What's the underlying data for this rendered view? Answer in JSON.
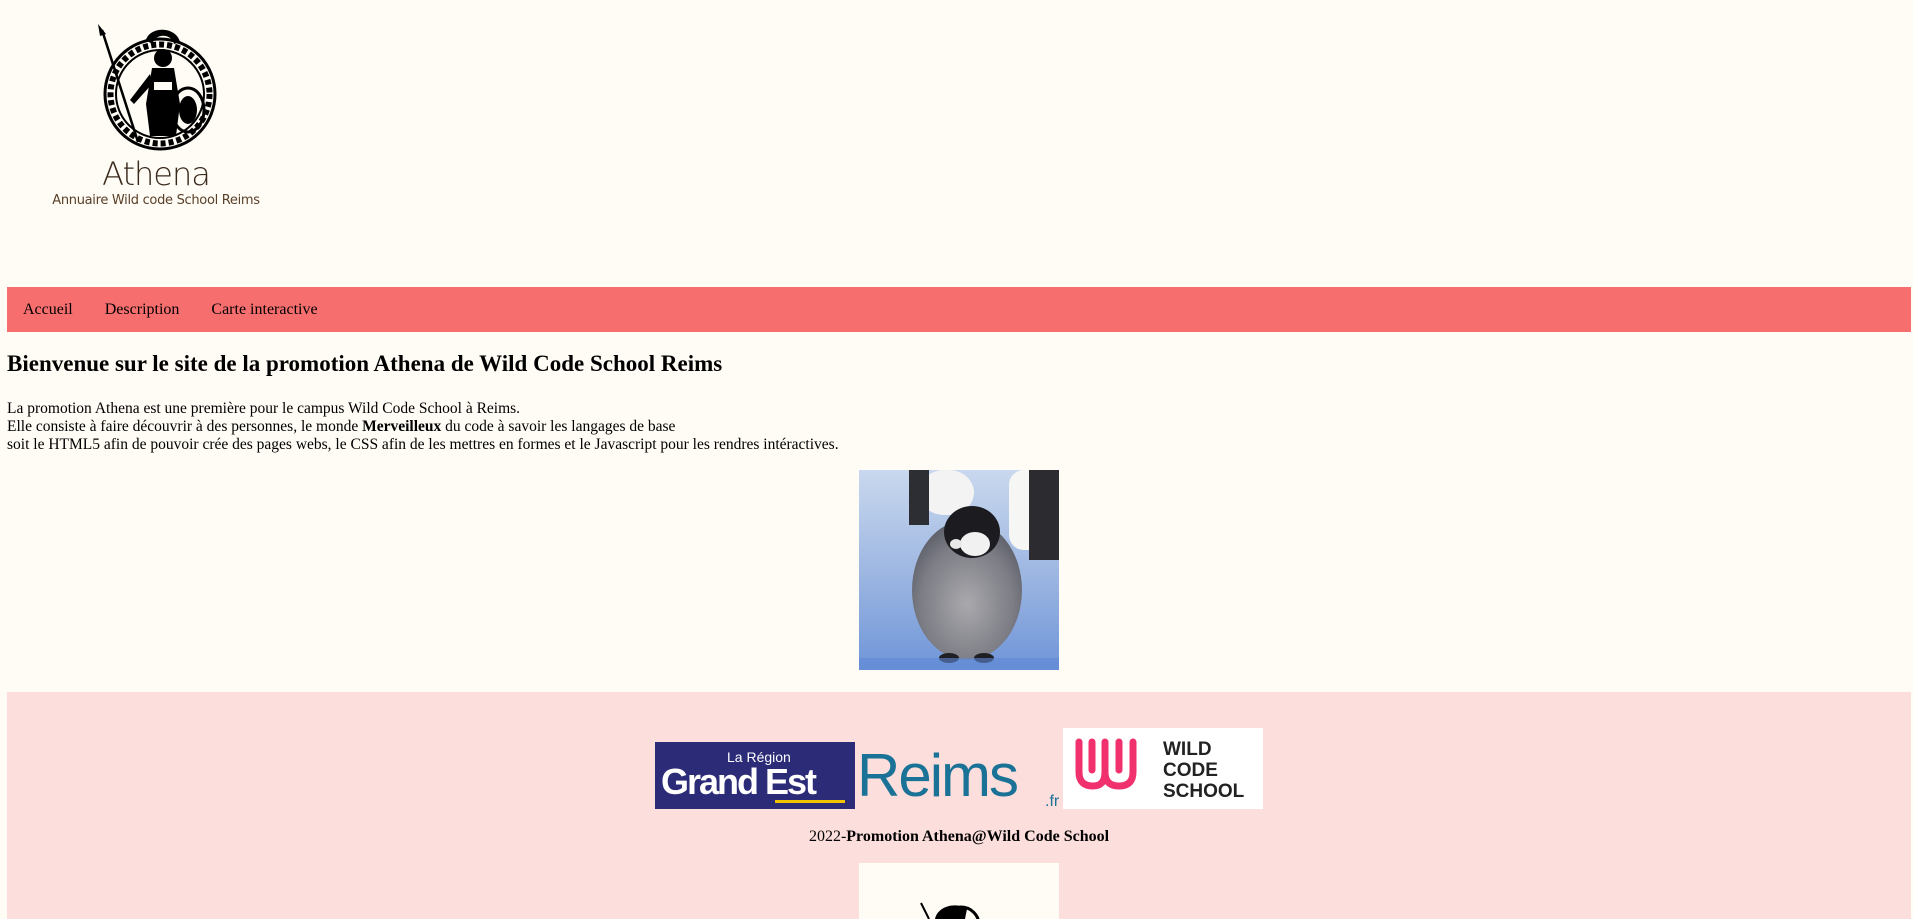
{
  "header": {
    "logo_name": "Athena",
    "logo_tagline": "Annuaire Wild code School Reims"
  },
  "nav": {
    "items": [
      "Accueil",
      "Description",
      "Carte interactive"
    ]
  },
  "main": {
    "title": "Bienvenue sur le site de la promotion Athena de Wild Code School Reims",
    "intro_line1": "La promotion Athena est une première pour le campus Wild Code School à Reims.",
    "intro_line2_before": "Elle consiste à faire découvrir à des personnes, le monde ",
    "intro_line2_bold": "Merveilleux",
    "intro_line2_after": " du code à savoir les langages de base",
    "intro_line3": "soit le HTML5 afin de pouvoir crée des pages webs, le CSS afin de les mettres en formes et le Javascript pour les rendres intéractives."
  },
  "footer": {
    "partners": {
      "grandest_top": "La Région",
      "grandest_main": "Grand Est",
      "reims_main": "Reims",
      "reims_suffix": ".fr",
      "wcs_line1": "WILD",
      "wcs_line2": "CODE",
      "wcs_line3": "SCHOOL"
    },
    "copyright_year": "2022-",
    "copyright_bold": "Promotion Athena@Wild Code School"
  },
  "colors": {
    "background": "#fffcf5",
    "nav": "#f76e6e",
    "footer": "#fcdedc",
    "grandest": "#2b2b78",
    "reims": "#1a7296",
    "wcs": "#f0316e"
  }
}
